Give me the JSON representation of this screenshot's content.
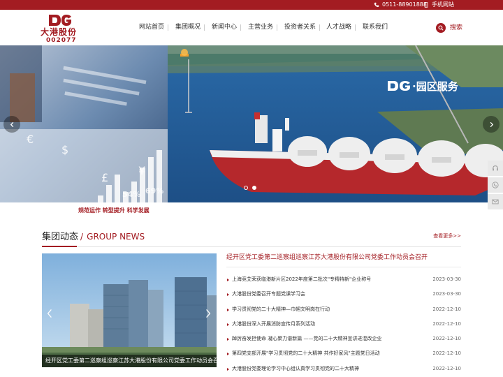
{
  "topbar": {
    "phone": "0511-88901888",
    "mobile_site": "手机网站"
  },
  "logo": {
    "name": "大港股份",
    "stock_code": "002077"
  },
  "nav": {
    "items": [
      {
        "label": "网站首页"
      },
      {
        "label": "集团概况"
      },
      {
        "label": "新闻中心"
      },
      {
        "label": "主营业务"
      },
      {
        "label": "投资者关系"
      },
      {
        "label": "人才战略"
      },
      {
        "label": "联系我们"
      }
    ]
  },
  "search": {
    "label": "搜索"
  },
  "banner": {
    "caption": "·园区服务",
    "slogan": "规范运作 转型提升 科学发展",
    "slides_total": 2,
    "active_slide": 2
  },
  "news": {
    "title_cn": "集团动态",
    "title_slash": "/",
    "title_en": "GROUP NEWS",
    "more": "查看更多>>",
    "photo_caption": "经开区党工委第二巡察组巡察江苏大港股份有限公司党委工作动员会召开",
    "headline": "经开区党工委第二巡察组巡察江苏大港股份有限公司党委工作动员会召开",
    "items": [
      {
        "text": "上海竞艾荣获临港新片区2022年度第二批次\"专精特新\"企业称号",
        "date": "2023-03-30"
      },
      {
        "text": "大港股份党委召开专题党课学习会",
        "date": "2023-03-30"
      },
      {
        "text": "学习贯彻党的二十大精神—巾帼文明岗在行动",
        "date": "2022-12-10"
      },
      {
        "text": "大港股份深入开展消防宣传月系列活动",
        "date": "2022-12-10"
      },
      {
        "text": "踔厉奋发担使命 凝心聚力谱新篇 ——党的二十大精神宣讲进混改企业",
        "date": "2022-12-10"
      },
      {
        "text": "第四党支部开展\"学习贯彻党的二十大精神 共作好家风\"主题党日活动",
        "date": "2022-12-10"
      },
      {
        "text": "大港股份党委理论学习中心组认真学习贯彻党的二十大精神",
        "date": "2022-12-10"
      }
    ]
  },
  "colors": {
    "brand_red": "#a31c22",
    "text_dark": "#333333",
    "date_gray": "#666666"
  },
  "icons": {
    "phone": "phone-icon",
    "mobile": "mobile-icon",
    "search": "search-icon",
    "banner_prev": "chevron-left-icon",
    "banner_next": "chevron-right-icon",
    "side_service": "headset-icon",
    "side_phone": "phone-icon",
    "side_mail": "mail-icon"
  }
}
